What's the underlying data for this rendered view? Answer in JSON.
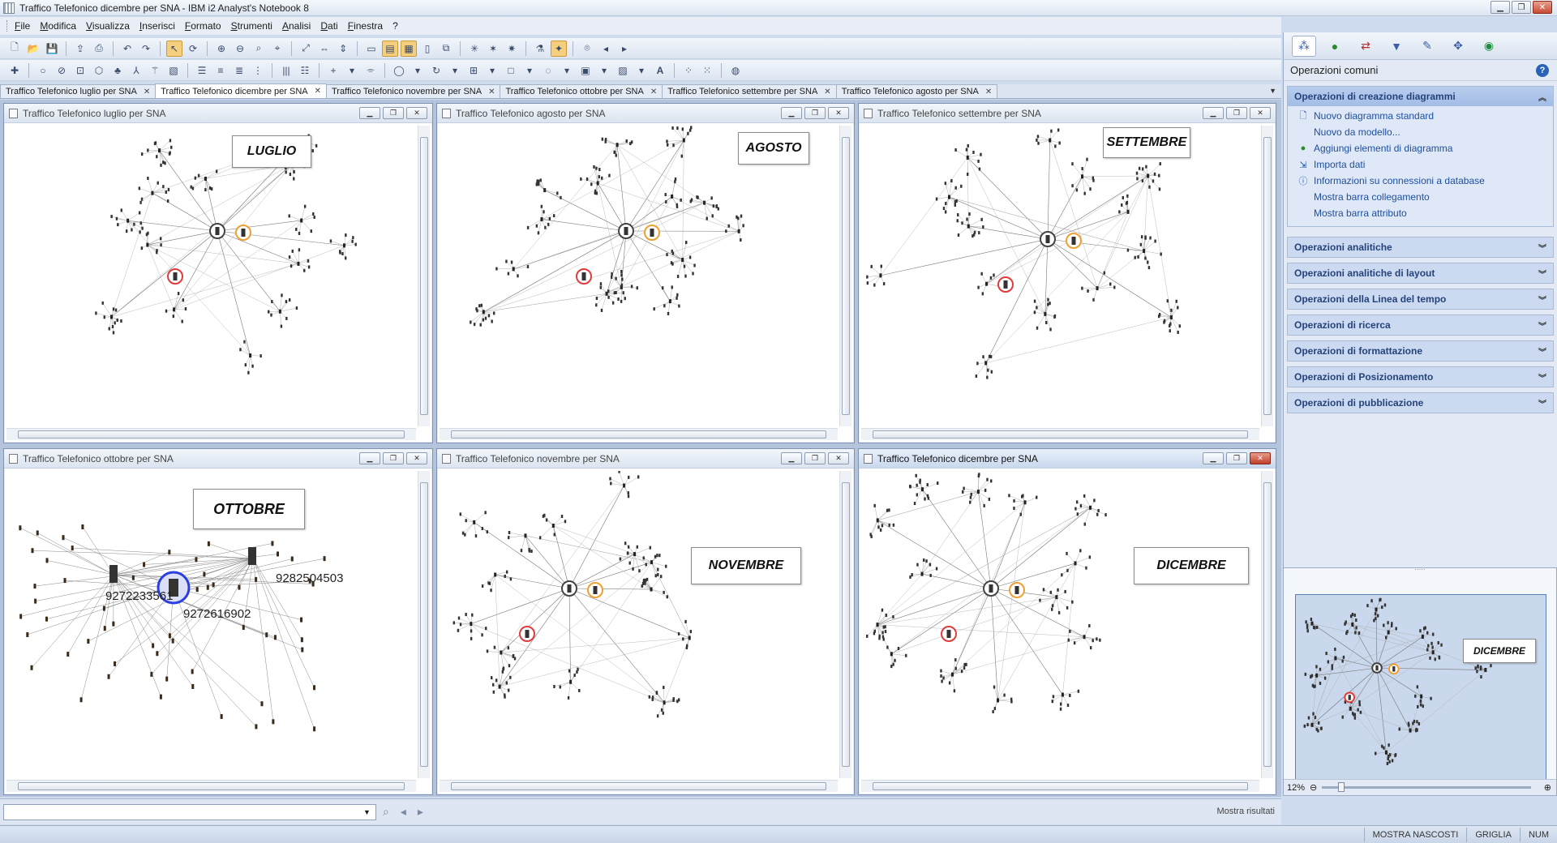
{
  "window": {
    "title": "Traffico Telefonico dicembre per SNA - IBM i2 Analyst's Notebook 8"
  },
  "menu": [
    "File",
    "Modifica",
    "Visualizza",
    "Inserisci",
    "Formato",
    "Strumenti",
    "Analisi",
    "Dati",
    "Finestra",
    "?"
  ],
  "doc_tabs": [
    "Traffico Telefonico luglio per SNA",
    "Traffico Telefonico dicembre per SNA",
    "Traffico Telefonico novembre per SNA",
    "Traffico Telefonico ottobre per SNA",
    "Traffico Telefonico settembre per SNA",
    "Traffico Telefonico agosto per SNA"
  ],
  "charts": {
    "luglio": {
      "caption": "Traffico Telefonico luglio per SNA",
      "month": "LUGLIO"
    },
    "agosto": {
      "caption": "Traffico Telefonico agosto per SNA",
      "month": "AGOSTO"
    },
    "settembre": {
      "caption": "Traffico Telefonico settembre per SNA",
      "month": "SETTEMBRE"
    },
    "ottobre": {
      "caption": "Traffico Telefonico ottobre per SNA",
      "month": "OTTOBRE",
      "numbers": [
        "9272233561",
        "9272616902",
        "9282504503"
      ]
    },
    "novembre": {
      "caption": "Traffico Telefonico novembre per SNA",
      "month": "NOVEMBRE"
    },
    "dicembre": {
      "caption": "Traffico Telefonico dicembre per SNA",
      "month": "DICEMBRE"
    }
  },
  "panel": {
    "header": "Operazioni comuni",
    "sections": [
      {
        "title": "Operazioni di creazione diagrammi",
        "open": true,
        "items": [
          "Nuovo diagramma standard",
          "Nuovo da modello...",
          "Aggiungi elementi di diagramma",
          "Importa dati",
          "Informazioni su connessioni a database",
          "Mostra barra collegamento",
          "Mostra barra attributo"
        ]
      },
      {
        "title": "Operazioni analitiche"
      },
      {
        "title": "Operazioni analitiche di layout"
      },
      {
        "title": "Operazioni della Linea del tempo"
      },
      {
        "title": "Operazioni di ricerca"
      },
      {
        "title": "Operazioni di formattazione"
      },
      {
        "title": "Operazioni di Posizionamento"
      },
      {
        "title": "Operazioni di pubblicazione"
      }
    ]
  },
  "overview": {
    "month": "DICEMBRE",
    "zoom": "12%"
  },
  "search": {
    "value": "",
    "mostra_label": "Mostra risultati"
  },
  "status": {
    "mostra_nascosti": "MOSTRA NASCOSTI",
    "griglia": "GRIGLIA",
    "num": "NUM"
  },
  "colors": {
    "red": "#e23b3b",
    "orange": "#f0a033",
    "blue": "#2b3fe0",
    "green": "#36c23a",
    "gray": "#444444"
  }
}
